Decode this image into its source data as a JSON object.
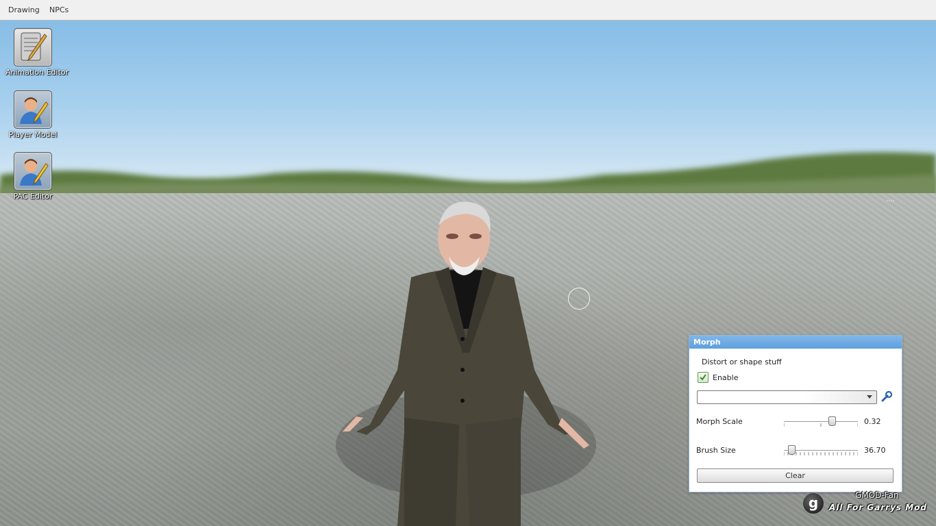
{
  "menubar": {
    "items": [
      {
        "label": "Drawing"
      },
      {
        "label": "NPCs"
      }
    ]
  },
  "desktop_icons": [
    {
      "label": "Animation Editor",
      "icon": "notepad-pencil-icon"
    },
    {
      "label": "Player Model",
      "icon": "user-edit-icon"
    },
    {
      "label": "PAC Editor",
      "icon": "user-edit-icon"
    }
  ],
  "morph_panel": {
    "title": "Morph",
    "description": "Distort or shape stuff",
    "enable_label": "Enable",
    "enable_checked": true,
    "dropdown_value": "",
    "morph_scale": {
      "label": "Morph Scale",
      "value": "0.32",
      "fraction": 0.65
    },
    "brush_size": {
      "label": "Brush Size",
      "value": "36.70",
      "fraction": 0.1
    },
    "clear_label": "Clear"
  },
  "watermark": {
    "logo_letter": "g",
    "line1": "GMOD-Fan",
    "line2": "All For Garrys Mod"
  },
  "scene_dots": "....",
  "colors": {
    "panel_title": "#6aa9e4",
    "sky": "#8fc3ea",
    "ground": "#a4a8a3"
  }
}
